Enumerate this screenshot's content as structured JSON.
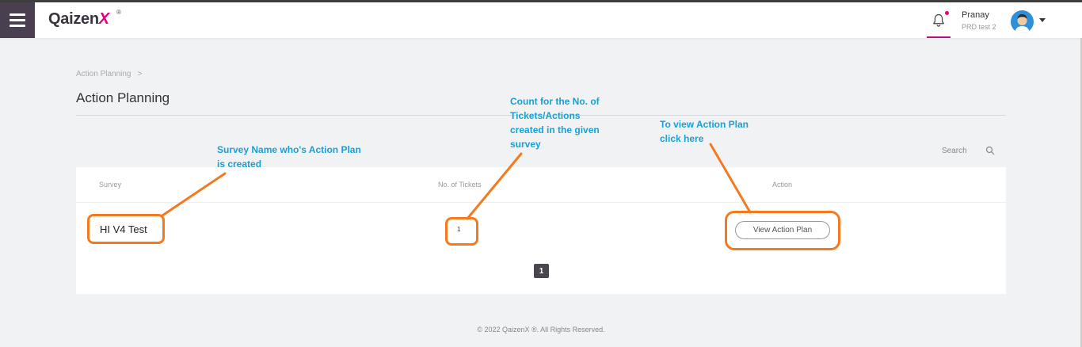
{
  "header": {
    "logo_text": "Qaizen",
    "logo_x": "X",
    "logo_reg": "®",
    "user_name": "Pranay",
    "user_org": "PRD test 2"
  },
  "icons": {
    "menu": "hamburger-icon",
    "bell": "bell-icon",
    "search": "search-icon",
    "avatar": "user-avatar",
    "caret": "caret-down-icon"
  },
  "colors": {
    "brand_dark": "#4a3f4f",
    "brand_accent": "#e6007e",
    "annotation_orange": "#f47a20",
    "annotation_blue": "#1a9fd6"
  },
  "breadcrumb": {
    "item": "Action Planning",
    "separator": ">"
  },
  "page_title": "Action Planning",
  "search": {
    "label": "Search"
  },
  "table": {
    "headers": [
      "Survey",
      "No. of Tickets",
      "Action"
    ],
    "rows": [
      {
        "survey": "HI V4 Test",
        "tickets": "1",
        "action_label": "View Action Plan"
      }
    ]
  },
  "pagination": {
    "current": "1"
  },
  "footer": "© 2022 QaizenX ®. All Rights Reserved.",
  "annotations": {
    "survey_note": [
      "Survey Name who's Action Plan",
      "is created"
    ],
    "tickets_note": [
      "Count for the No. of",
      "Tickets/Actions",
      "created in the given",
      "survey"
    ],
    "action_note": [
      "To view Action Plan",
      "click here"
    ]
  }
}
